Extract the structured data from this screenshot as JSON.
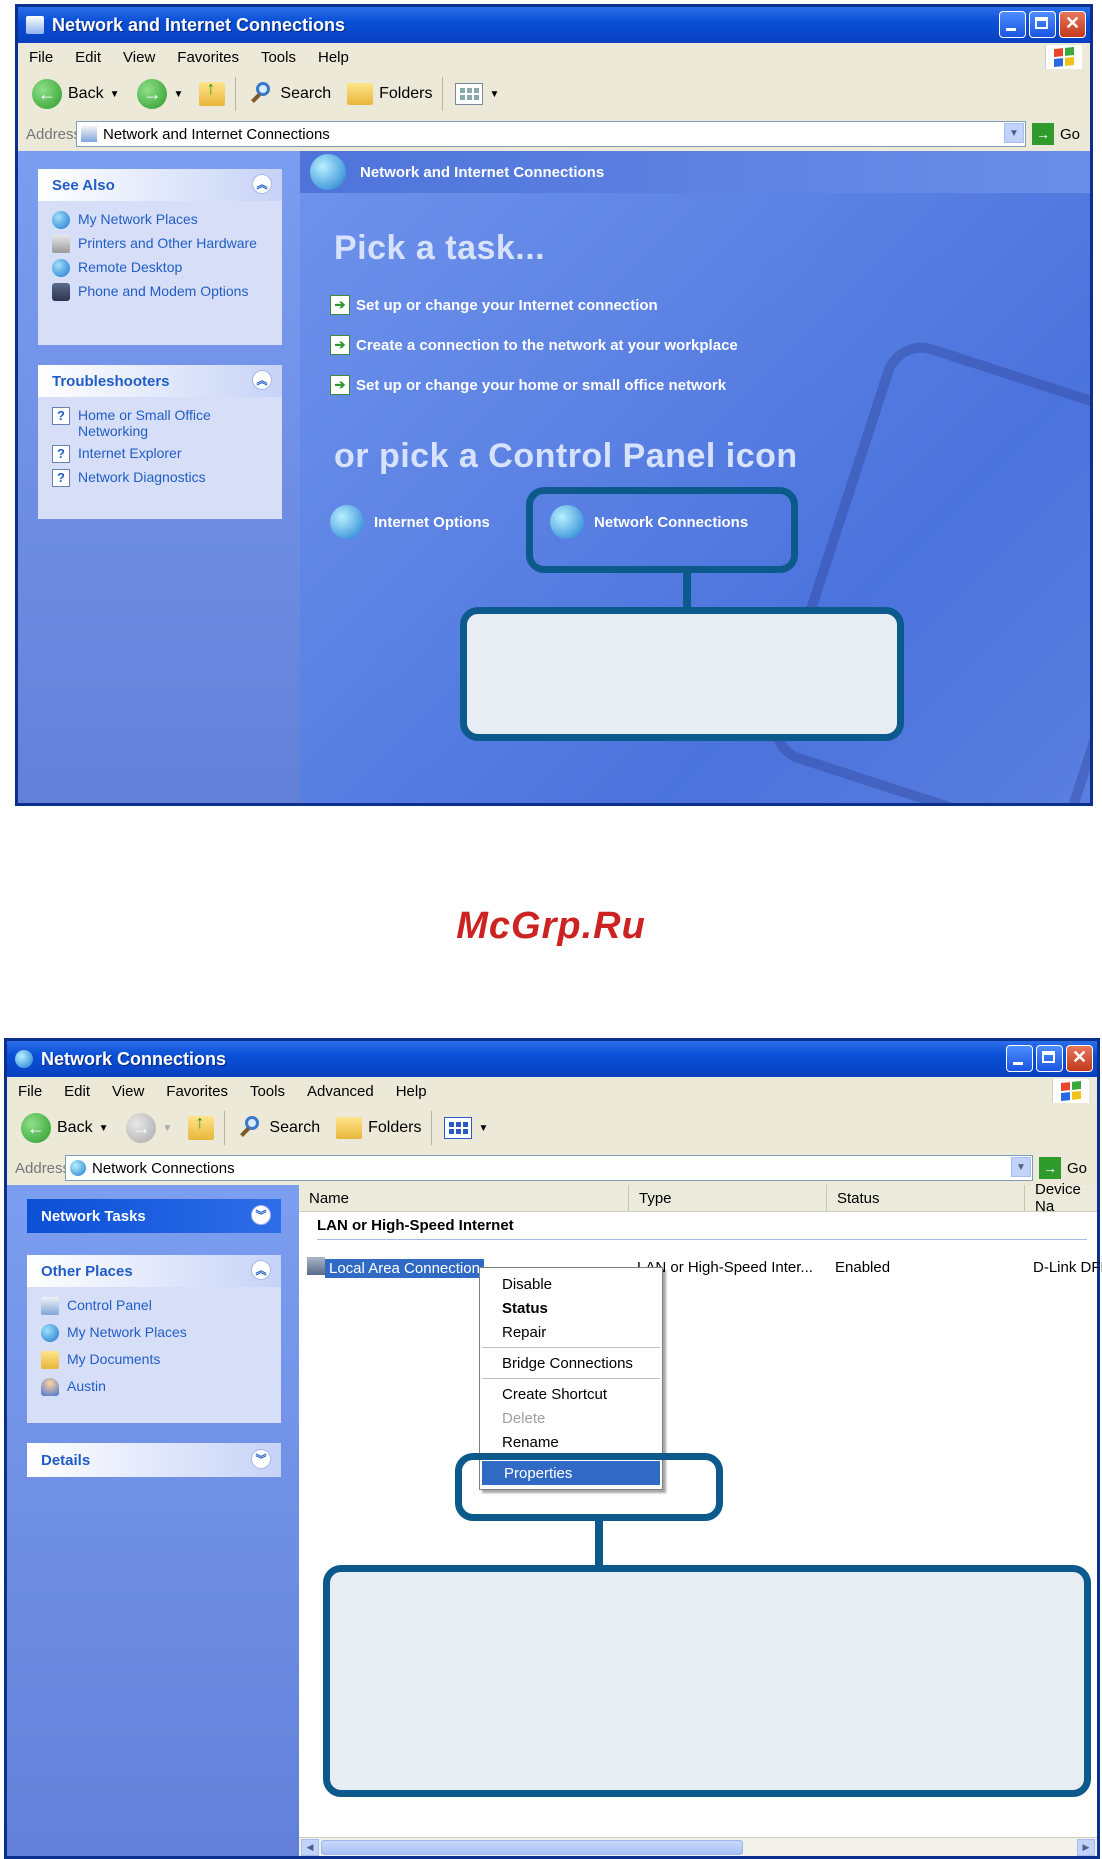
{
  "top_window": {
    "title": "Network and Internet Connections",
    "menu": [
      "File",
      "Edit",
      "View",
      "Favorites",
      "Tools",
      "Help"
    ],
    "toolbar": {
      "back": "Back",
      "search": "Search",
      "folders": "Folders"
    },
    "address": {
      "label": "Address",
      "value": "Network and Internet Connections",
      "go": "Go"
    },
    "see_also": {
      "title": "See Also",
      "items": [
        "My Network Places",
        "Printers and Other Hardware",
        "Remote Desktop",
        "Phone and Modem Options"
      ]
    },
    "troubleshooters": {
      "title": "Troubleshooters",
      "items": [
        "Home or Small Office Networking",
        "Internet Explorer",
        "Network Diagnostics"
      ]
    },
    "header": "Network and Internet Connections",
    "pick_task": "Pick a task...",
    "tasks": [
      "Set up or change your Internet connection",
      "Create a connection to the network at your workplace",
      "Set up or change your home or small office network"
    ],
    "pick_icon": "or pick a Control Panel icon",
    "icons": [
      "Internet Options",
      "Network Connections"
    ]
  },
  "watermark": "McGrp.Ru",
  "bottom_window": {
    "title": "Network Connections",
    "menu": [
      "File",
      "Edit",
      "View",
      "Favorites",
      "Tools",
      "Advanced",
      "Help"
    ],
    "toolbar": {
      "back": "Back",
      "search": "Search",
      "folders": "Folders"
    },
    "address": {
      "label": "Address",
      "value": "Network Connections",
      "go": "Go"
    },
    "network_tasks": {
      "title": "Network Tasks"
    },
    "other_places": {
      "title": "Other Places",
      "items": [
        "Control Panel",
        "My Network Places",
        "My Documents",
        "Austin"
      ]
    },
    "details": {
      "title": "Details"
    },
    "columns": [
      "Name",
      "Type",
      "Status",
      "Device Na"
    ],
    "group": "LAN or High-Speed Internet",
    "row": {
      "name": "Local Area Connection",
      "type": "LAN or High-Speed Inter...",
      "status": "Enabled",
      "device": "D-Link DFE"
    },
    "context_menu": [
      "Disable",
      "Status",
      "Repair",
      "Bridge Connections",
      "Create Shortcut",
      "Delete",
      "Rename",
      "Properties"
    ]
  }
}
